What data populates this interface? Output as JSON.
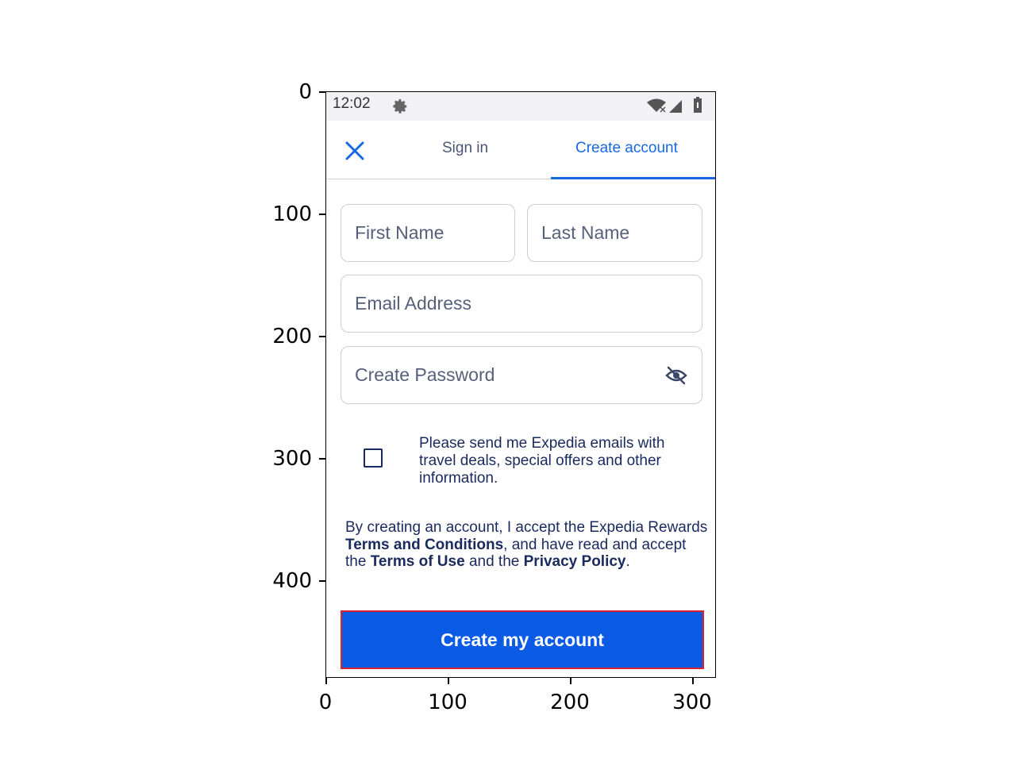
{
  "axes": {
    "y_ticks": [
      "0",
      "100",
      "200",
      "300",
      "400"
    ],
    "x_ticks": [
      "0",
      "100",
      "200",
      "300"
    ]
  },
  "status_bar": {
    "time": "12:02",
    "icons": [
      "gear-icon",
      "wifi-icon",
      "signal-icon",
      "battery-icon"
    ]
  },
  "nav": {
    "close_icon": "close-icon",
    "tabs": [
      {
        "label": "Sign in",
        "active": false
      },
      {
        "label": "Create account",
        "active": true
      }
    ]
  },
  "form": {
    "first_name": {
      "placeholder": "First Name",
      "value": ""
    },
    "last_name": {
      "placeholder": "Last Name",
      "value": ""
    },
    "email": {
      "placeholder": "Email Address",
      "value": ""
    },
    "password": {
      "placeholder": "Create Password",
      "value": "",
      "toggle_icon": "eye-slash-icon"
    },
    "optin": {
      "checked": false,
      "label": "Please send me Expedia emails with travel deals, special offers and other information."
    },
    "legal": {
      "part1": "By creating an account, I accept the Expedia Rewards ",
      "terms_conditions": "Terms and Conditions",
      "part2": ", and have read and accept the ",
      "terms_of_use": "Terms of Use",
      "part3": " and the ",
      "privacy_policy": "Privacy Policy",
      "part4": "."
    },
    "submit_label": "Create my account"
  },
  "colors": {
    "accent": "#1668e3",
    "button": "#0b5be6",
    "highlight_border": "#d8232a",
    "text_dark": "#1a2a5e"
  }
}
